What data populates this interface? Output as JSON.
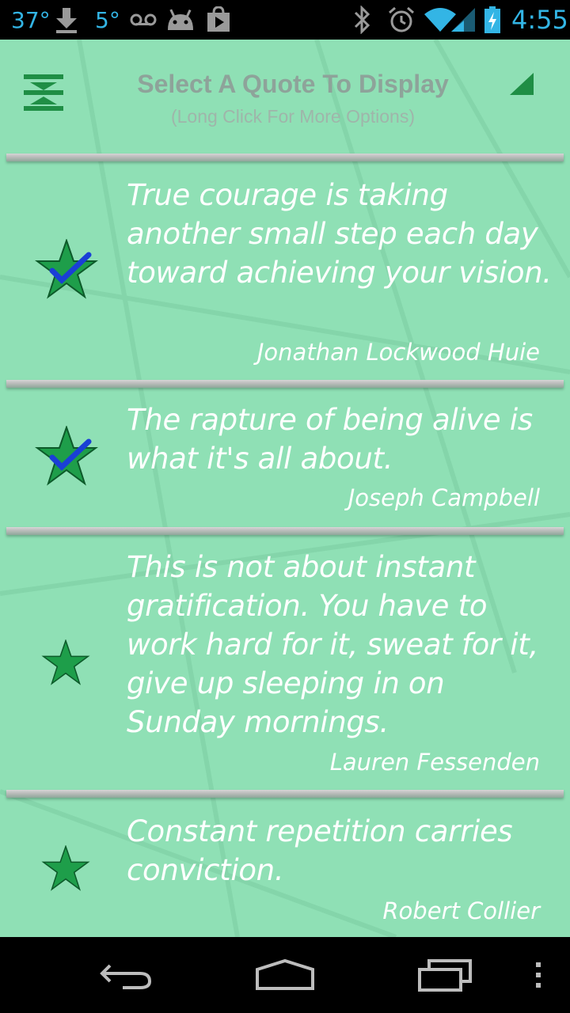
{
  "status_bar": {
    "temperature": "37°",
    "temperature2": "5°",
    "time": "4:55",
    "icons": [
      "download-icon",
      "voicemail-icon",
      "android-icon",
      "play-store-icon",
      "bluetooth-icon",
      "alarm-icon",
      "wifi-icon",
      "signal-icon",
      "battery-charging-icon"
    ]
  },
  "header": {
    "title": "Select A Quote To Display",
    "subtitle": "(Long Click For More Options)"
  },
  "quotes": [
    {
      "text": "True courage is taking another small step each day toward achieving your vision.",
      "author": "Jonathan Lockwood Huie",
      "selected": true
    },
    {
      "text": "The rapture of being alive is what it's all about.",
      "author": "Joseph Campbell",
      "selected": true
    },
    {
      "text": "This is not about instant gratification. You have to work hard for it, sweat for it, give up sleeping in on Sunday mornings.",
      "author": "Lauren Fessenden",
      "selected": false
    },
    {
      "text": "Constant repetition carries conviction.",
      "author": "Robert Collier",
      "selected": false
    }
  ],
  "colors": {
    "background": "#8fe0b5",
    "star_green": "#1e9e4a",
    "check_blue": "#1a3fd6",
    "status_blue": "#33b5e5"
  }
}
